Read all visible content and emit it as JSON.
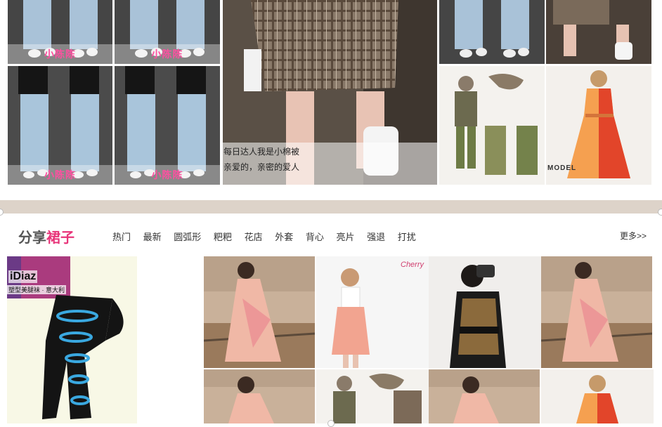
{
  "top_grid": {
    "watermarks": [
      "小陈陈",
      "小陈陈",
      "小陈陈",
      "小陈陈"
    ],
    "featured_caption": [
      "每日达人我是小棉被",
      "亲爱的，亲密的爱人"
    ],
    "model_tag": "MODEL"
  },
  "section": {
    "title_prefix": "分享",
    "title_highlight": "裙子",
    "tabs": [
      "热门",
      "最新",
      "圆弧形",
      "粑粑",
      "花店",
      "外套",
      "背心",
      "亮片",
      "强退",
      "打扰"
    ],
    "more_label": "更多>>"
  },
  "bottom_grid": {
    "ad_brand": "iDiaz",
    "ad_slogan": "塑型美腿袜 · 意大利",
    "brand_tag": "Cherry"
  }
}
